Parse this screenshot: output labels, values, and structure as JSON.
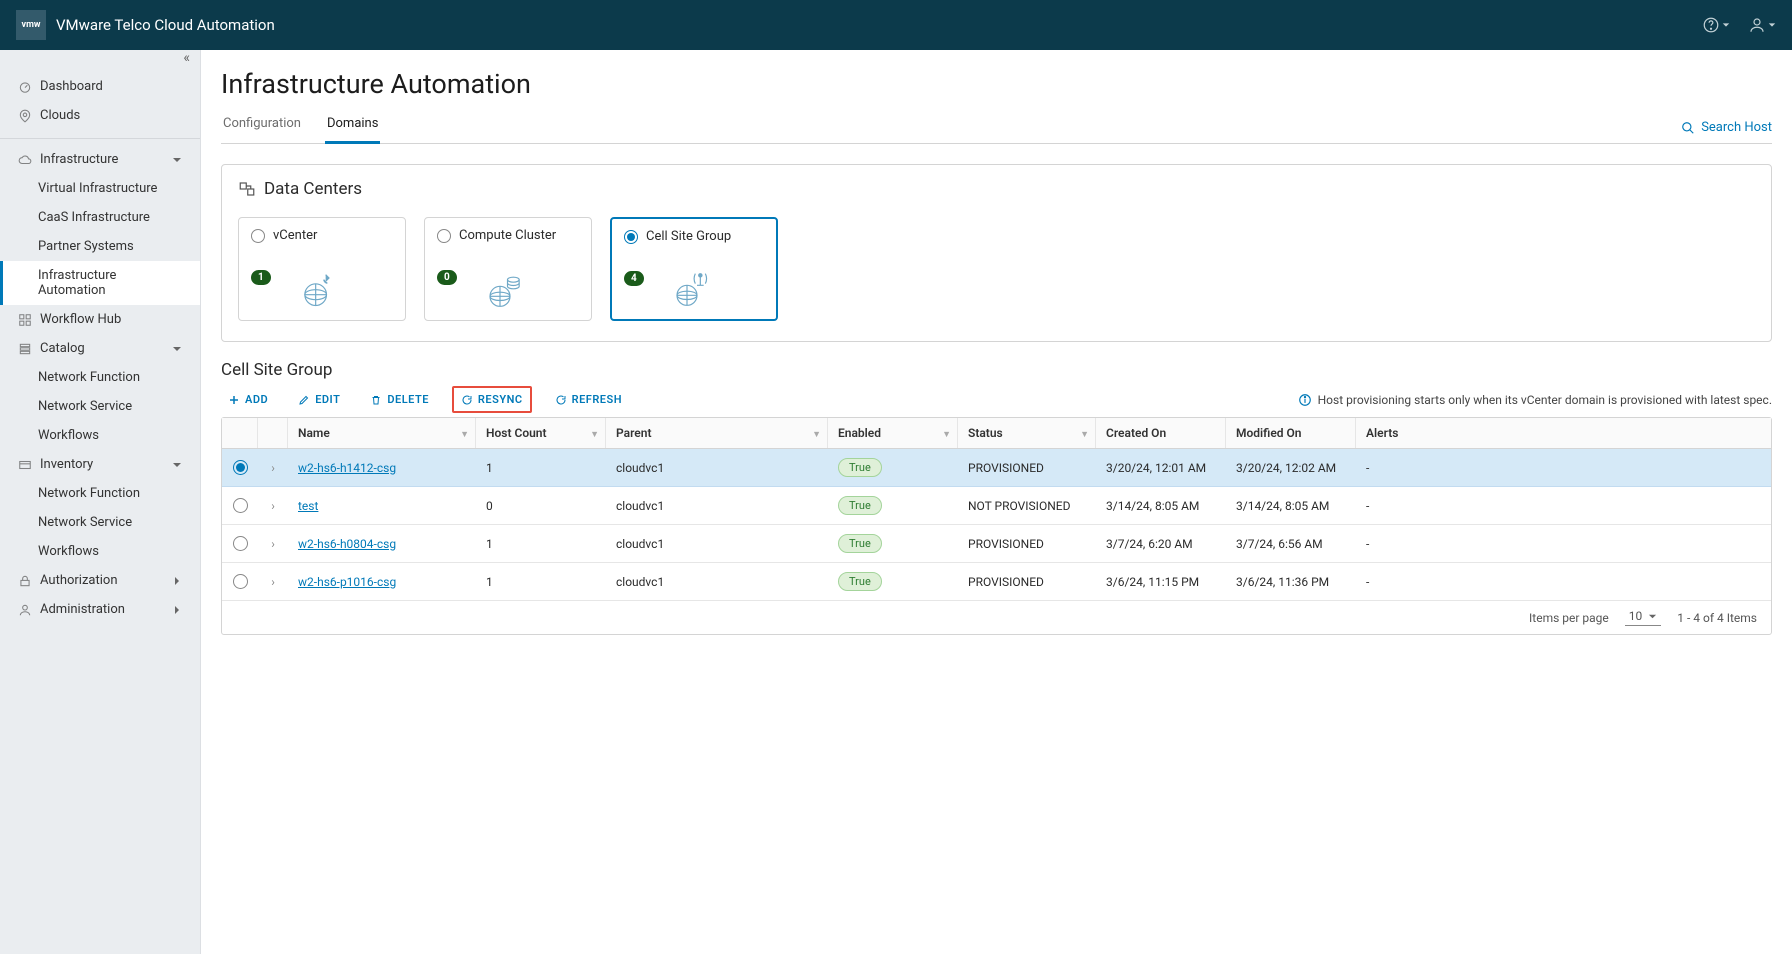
{
  "header": {
    "logo": "vmw",
    "product": "VMware Telco Cloud Automation"
  },
  "sidebar": {
    "dashboard": "Dashboard",
    "clouds": "Clouds",
    "infrastructure": {
      "title": "Infrastructure",
      "items": [
        "Virtual Infrastructure",
        "CaaS Infrastructure",
        "Partner Systems",
        "Infrastructure Automation"
      ]
    },
    "workflow_hub": "Workflow Hub",
    "catalog": {
      "title": "Catalog",
      "items": [
        "Network Function",
        "Network Service",
        "Workflows"
      ]
    },
    "inventory": {
      "title": "Inventory",
      "items": [
        "Network Function",
        "Network Service",
        "Workflows"
      ]
    },
    "authorization": "Authorization",
    "administration": "Administration"
  },
  "page": {
    "title": "Infrastructure Automation",
    "tabs": [
      "Configuration",
      "Domains"
    ],
    "search_host": "Search Host"
  },
  "datacenters": {
    "heading": "Data Centers",
    "cards": [
      {
        "label": "vCenter",
        "count": "1"
      },
      {
        "label": "Compute Cluster",
        "count": "0"
      },
      {
        "label": "Cell Site Group",
        "count": "4"
      }
    ]
  },
  "section_title": "Cell Site Group",
  "toolbar": {
    "add": "ADD",
    "edit": "EDIT",
    "delete": "DELETE",
    "resync": "RESYNC",
    "refresh": "REFRESH",
    "info": "Host provisioning starts only when its vCenter domain is provisioned with latest spec."
  },
  "grid": {
    "headers": {
      "name": "Name",
      "host_count": "Host Count",
      "parent": "Parent",
      "enabled": "Enabled",
      "status": "Status",
      "created": "Created On",
      "modified": "Modified On",
      "alerts": "Alerts"
    },
    "rows": [
      {
        "name": "w2-hs6-h1412-csg",
        "host": "1",
        "parent": "cloudvc1",
        "enabled": "True",
        "status": "PROVISIONED",
        "created": "3/20/24, 12:01 AM",
        "modified": "3/20/24, 12:02 AM",
        "alerts": "-",
        "selected": true
      },
      {
        "name": "test",
        "host": "0",
        "parent": "cloudvc1",
        "enabled": "True",
        "status": "NOT PROVISIONED",
        "created": "3/14/24, 8:05 AM",
        "modified": "3/14/24, 8:05 AM",
        "alerts": "-",
        "selected": false
      },
      {
        "name": "w2-hs6-h0804-csg",
        "host": "1",
        "parent": "cloudvc1",
        "enabled": "True",
        "status": "PROVISIONED",
        "created": "3/7/24, 6:20 AM",
        "modified": "3/7/24, 6:56 AM",
        "alerts": "-",
        "selected": false
      },
      {
        "name": "w2-hs6-p1016-csg",
        "host": "1",
        "parent": "cloudvc1",
        "enabled": "True",
        "status": "PROVISIONED",
        "created": "3/6/24, 11:15 PM",
        "modified": "3/6/24, 11:36 PM",
        "alerts": "-",
        "selected": false
      }
    ],
    "footer": {
      "ipp_label": "Items per page",
      "ipp_value": "10",
      "range": "1 - 4 of 4 Items"
    }
  }
}
